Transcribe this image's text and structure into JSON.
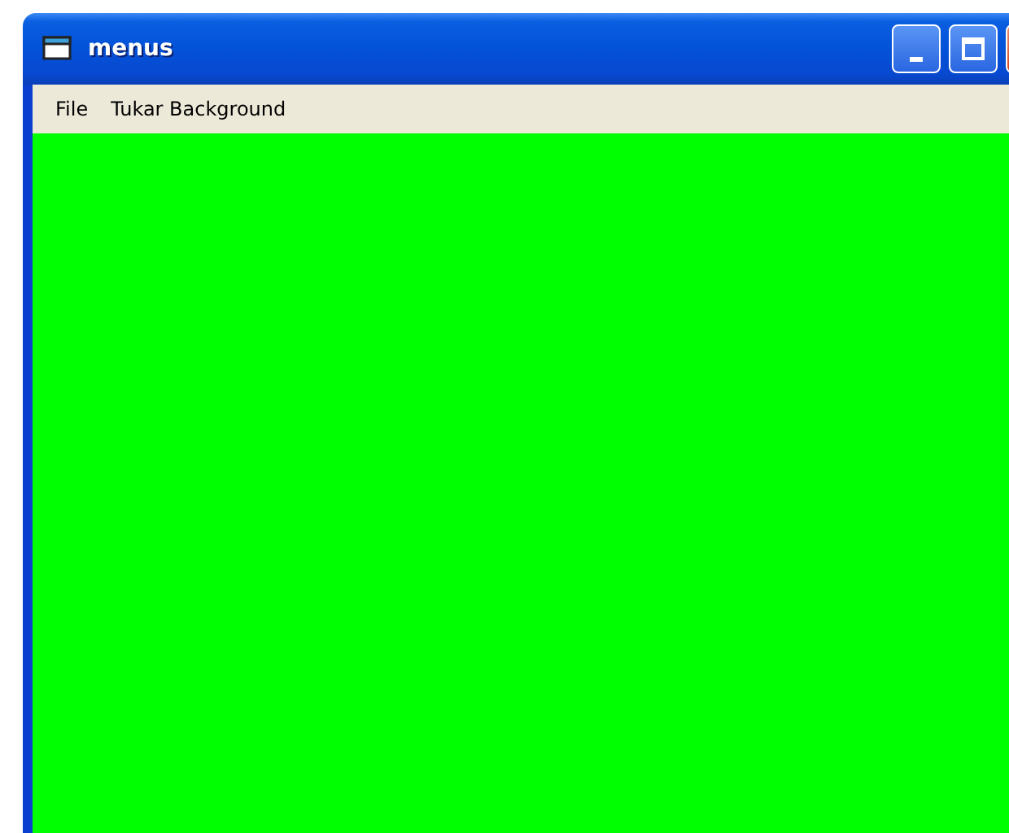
{
  "window": {
    "title": "menus"
  },
  "menu": [
    {
      "label": "File"
    },
    {
      "label": "Tukar Background"
    }
  ]
}
